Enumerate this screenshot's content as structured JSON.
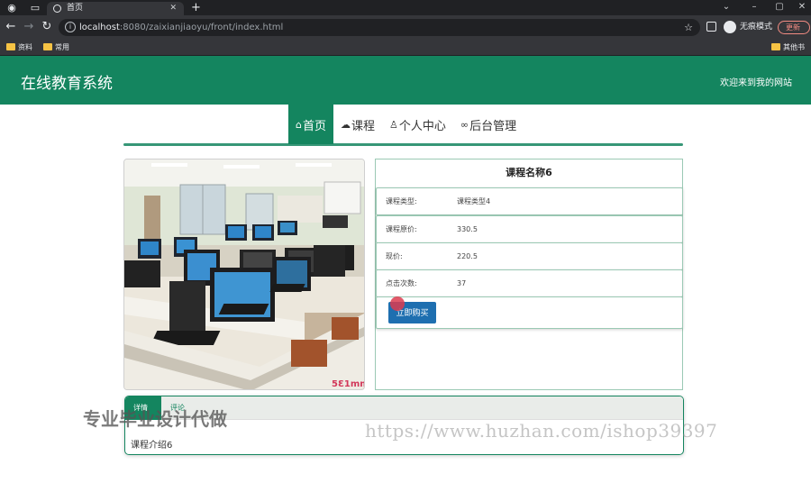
{
  "browser": {
    "tab_title": "首页",
    "url_host": "localhost",
    "url_rest": ":8080/zaixianjiaoyu/front/index.html",
    "incognito_label": "无痕模式",
    "update_label": "更新",
    "bookmarks": [
      "资料",
      "常用"
    ],
    "other_bookmarks": "其他书签"
  },
  "site": {
    "title": "在线教育系统",
    "welcome": "欢迎来到我的网站"
  },
  "nav": [
    {
      "label": "首页",
      "icon": "home-icon"
    },
    {
      "label": "课程",
      "icon": "cloud-icon"
    },
    {
      "label": "个人中心",
      "icon": "user-icon"
    },
    {
      "label": "后台管理",
      "icon": "link-icon"
    }
  ],
  "course": {
    "title": "课程名称6",
    "fields": [
      {
        "label": "课程类型:",
        "value": "课程类型4"
      },
      {
        "label": "课程原价:",
        "value": "330.5"
      },
      {
        "label": "现价:",
        "value": "220.5"
      },
      {
        "label": "点击次数:",
        "value": "37"
      }
    ],
    "buy_label": "立即购买"
  },
  "intro": {
    "tab_active": "详情",
    "tab_other": "评论",
    "content": "课程介绍6"
  },
  "watermarks": {
    "cn": "专业毕业设计代做",
    "url": "https://www.huzhan.com/ishop39397"
  },
  "colors": {
    "brand": "#14855f",
    "buy_button": "#1e6fb0"
  }
}
